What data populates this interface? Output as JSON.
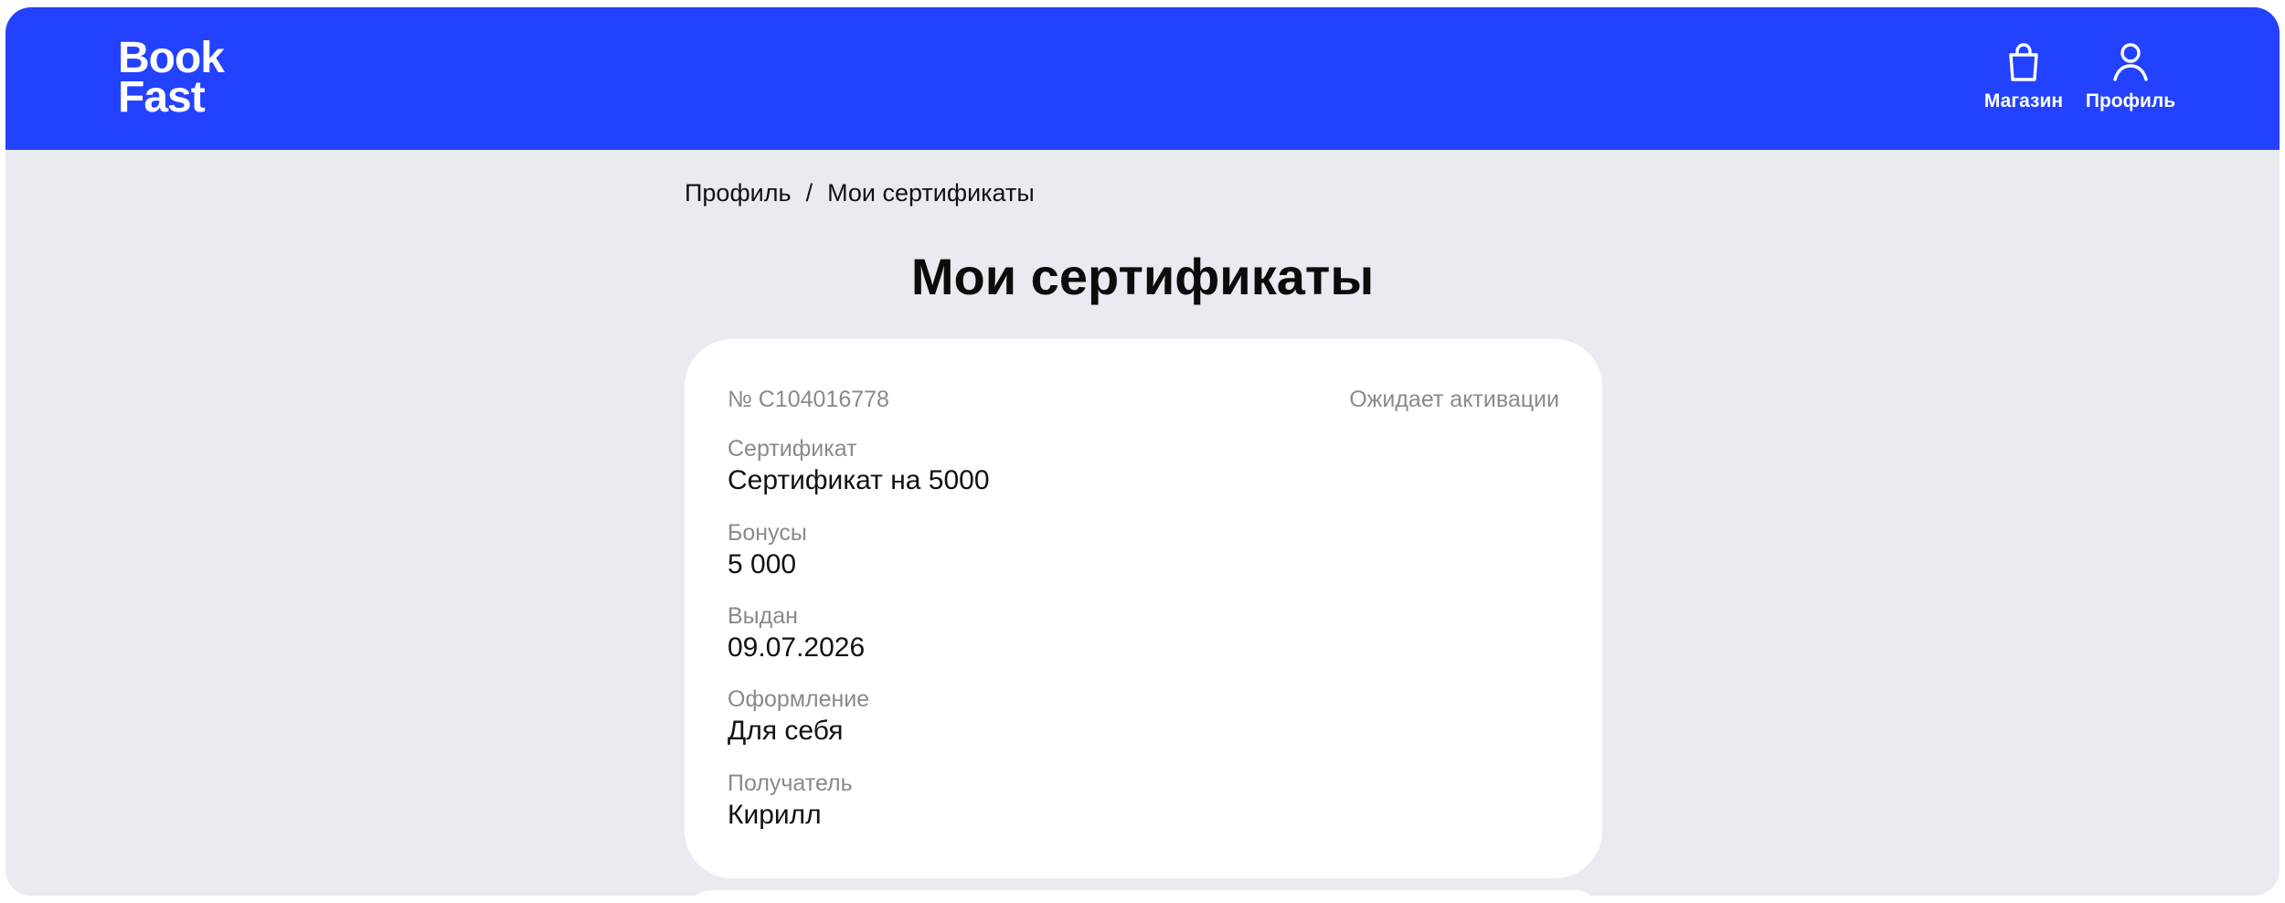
{
  "header": {
    "logo": {
      "line1": "Book",
      "line2": "Fast"
    },
    "nav": {
      "shop_label": "Магазин",
      "profile_label": "Профиль"
    }
  },
  "breadcrumb": {
    "parent": "Профиль",
    "separator": "/",
    "current": "Мои сертификаты"
  },
  "page": {
    "title": "Мои сертификаты"
  },
  "certificate": {
    "number": "№ C104016778",
    "status": "Ожидает активации",
    "fields": [
      {
        "label": "Сертификат",
        "value": "Сертификат на 5000"
      },
      {
        "label": "Бонусы",
        "value": "5 000"
      },
      {
        "label": "Выдан",
        "value": "09.07.2026"
      },
      {
        "label": "Оформление",
        "value": "Для себя"
      },
      {
        "label": "Получатель",
        "value": "Кирилл"
      }
    ]
  },
  "colors": {
    "brand": "#2342ff",
    "background": "#eaebf0",
    "card": "#ffffff",
    "muted_text": "#8a8a8a"
  }
}
